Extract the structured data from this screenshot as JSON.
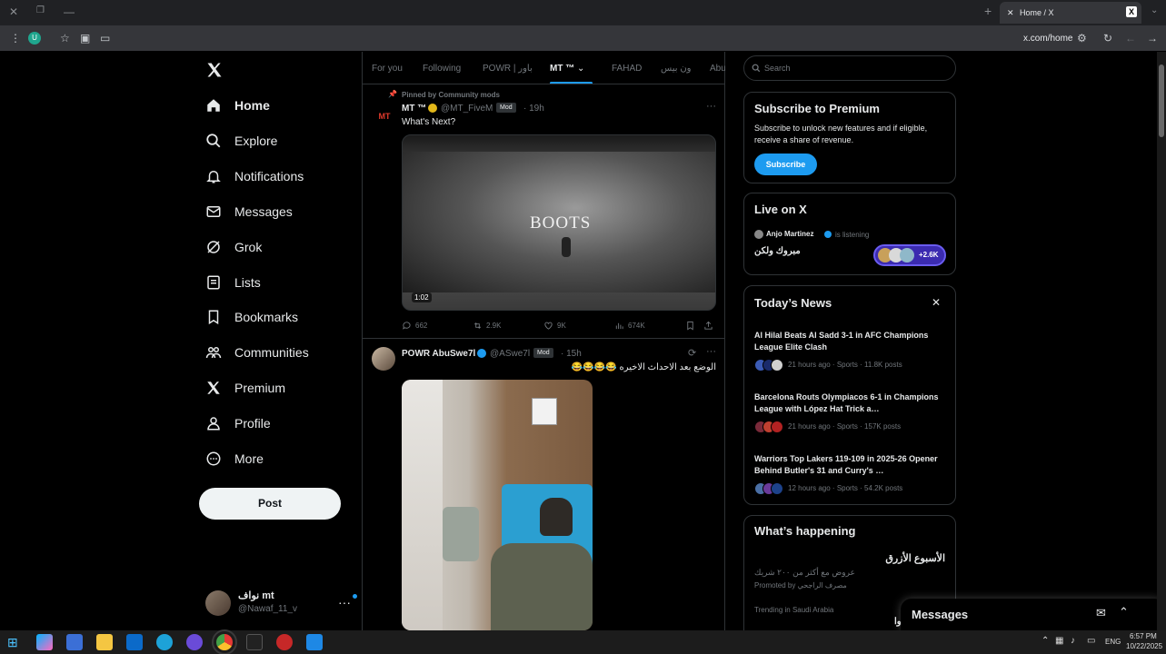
{
  "browser": {
    "tab_title": "Home / X",
    "url": "x.com/home",
    "profile_initial": "U"
  },
  "nav": {
    "items": [
      {
        "label": "Home",
        "icon": "home-icon"
      },
      {
        "label": "Explore",
        "icon": "search-icon"
      },
      {
        "label": "Notifications",
        "icon": "bell-icon"
      },
      {
        "label": "Messages",
        "icon": "envelope-icon"
      },
      {
        "label": "Grok",
        "icon": "grok-icon"
      },
      {
        "label": "Lists",
        "icon": "list-icon"
      },
      {
        "label": "Bookmarks",
        "icon": "bookmark-icon"
      },
      {
        "label": "Communities",
        "icon": "communities-icon"
      },
      {
        "label": "Premium",
        "icon": "x-logo-icon"
      },
      {
        "label": "Profile",
        "icon": "profile-icon"
      },
      {
        "label": "More",
        "icon": "more-circle-icon"
      }
    ],
    "post_label": "Post",
    "account_name": "نواف mt",
    "account_handle": "@Nawaf_11_v"
  },
  "timeline": {
    "tabs": [
      "For you",
      "Following",
      "POWR | باور",
      "MT ™",
      "FAHAD",
      "ون بيس",
      "Abu"
    ],
    "active_tab_index": 3,
    "tweet1": {
      "pinned": "Pinned by Community mods",
      "name": "MT ™",
      "handle": "@MT_FiveM",
      "badge": "Mod",
      "time": "· 19h",
      "text": "What's Next?",
      "video_title": "BOOTS",
      "video_duration": "1:02",
      "replies": "662",
      "reposts": "2.9K",
      "likes": "9K",
      "views": "674K"
    },
    "tweet2": {
      "name": "POWR AbuSwe7l",
      "handle": "@ASwe7l",
      "badge": "Mod",
      "time": "· 15h",
      "text": "الوضع بعد الاحداث الاخيره 😂😂😂😂"
    }
  },
  "right": {
    "search_placeholder": "Search",
    "premium": {
      "title": "Subscribe to Premium",
      "body": "Subscribe to unlock new features and if eligible, receive a share of revenue.",
      "button": "Subscribe"
    },
    "live": {
      "title": "Live on X",
      "host": "Anjo Martinez",
      "status": "is listening",
      "space_title": "مبروك ولكن",
      "count": "+2.6K"
    },
    "news": {
      "title": "Today’s News",
      "items": [
        {
          "headline": "Al Hilal Beats Al Sadd 3-1 in AFC Champions League Elite Clash",
          "meta": "21 hours ago · Sports · 11.8K posts"
        },
        {
          "headline": "Barcelona Routs Olympiacos 6-1 in Champions League with López Hat Trick a…",
          "meta": "21 hours ago · Sports · 157K posts"
        },
        {
          "headline": "Warriors Top Lakers 119-109 in 2025-26 Opener Behind Butler's 31 and Curry's …",
          "meta": "12 hours ago · Sports · 54.2K posts"
        }
      ]
    },
    "happening": {
      "title": "What’s happening",
      "promo_title": "الأسبوع الأزرق",
      "promo_text": "عروض مع أكثر من ٢٠٠ شريك",
      "promo_by": "Promoted by مصرف الراجحي",
      "trend_ctx": "Trending in Saudi Arabia",
      "trend_snip": "وا"
    },
    "messages_label": "Messages"
  },
  "taskbar": {
    "lang": "ENG",
    "time": "6:57 PM",
    "date": "10/22/2025"
  },
  "colors": {
    "accent": "#1d9bf0",
    "background": "#000000",
    "border": "#2f3336",
    "muted": "#71767b"
  }
}
